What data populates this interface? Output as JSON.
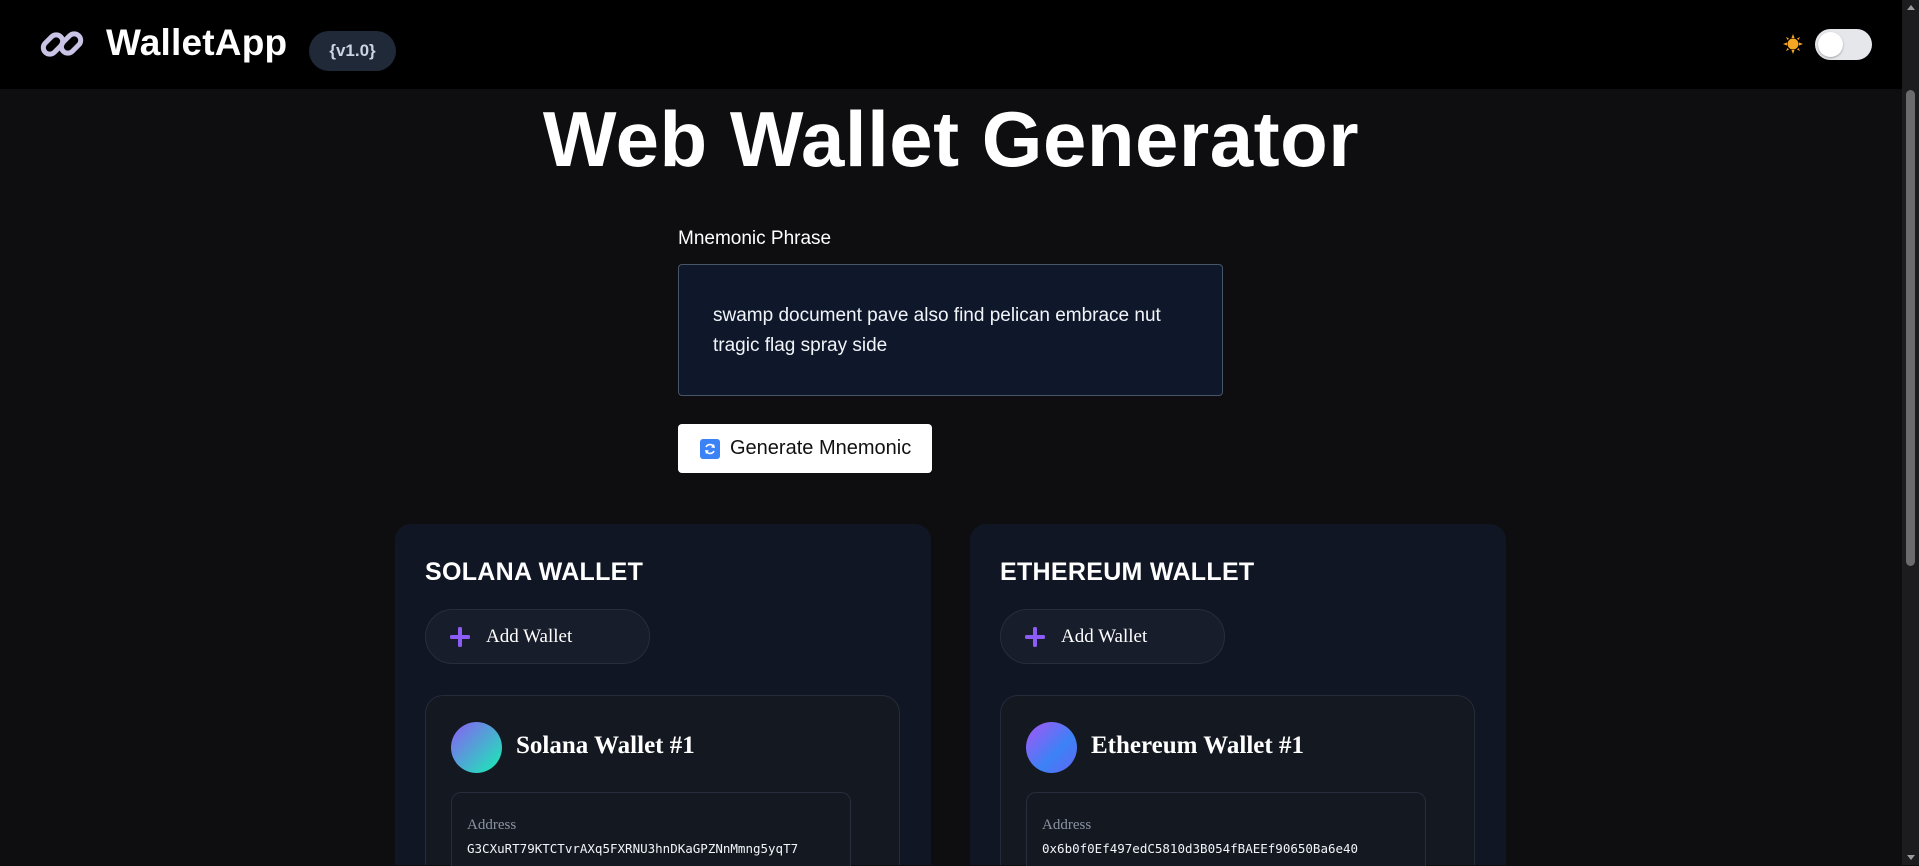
{
  "header": {
    "app_title": "WalletApp",
    "version": "{v1.0}",
    "logo_icon": "link-icon",
    "theme_icon": "sun-icon",
    "theme_toggle_state": "off"
  },
  "main": {
    "title": "Web Wallet Generator",
    "mnemonic": {
      "label": "Mnemonic Phrase",
      "value": "swamp document pave also find pelican embrace nut tragic flag spray side"
    },
    "generate_button": {
      "label": "Generate Mnemonic",
      "icon": "refresh-icon"
    }
  },
  "wallets": [
    {
      "title": "SOLANA WALLET",
      "add_label": "Add Wallet",
      "card": {
        "name": "Solana Wallet #1",
        "address_label": "Address",
        "address": "G3CXuRT79KTCTvrAXq5FXRNU3hnDKaGPZNnMmng5yqT7"
      }
    },
    {
      "title": "ETHEREUM WALLET",
      "add_label": "Add Wallet",
      "card": {
        "name": "Ethereum Wallet #1",
        "address_label": "Address",
        "address": "0x6b0f0Ef497edC5810d3B054fBAEEf90650Ba6e40"
      }
    }
  ],
  "colors": {
    "background": "#0e0e11",
    "header": "#000000",
    "panel": "#101624",
    "accent_purple": "#8b5cf6"
  }
}
